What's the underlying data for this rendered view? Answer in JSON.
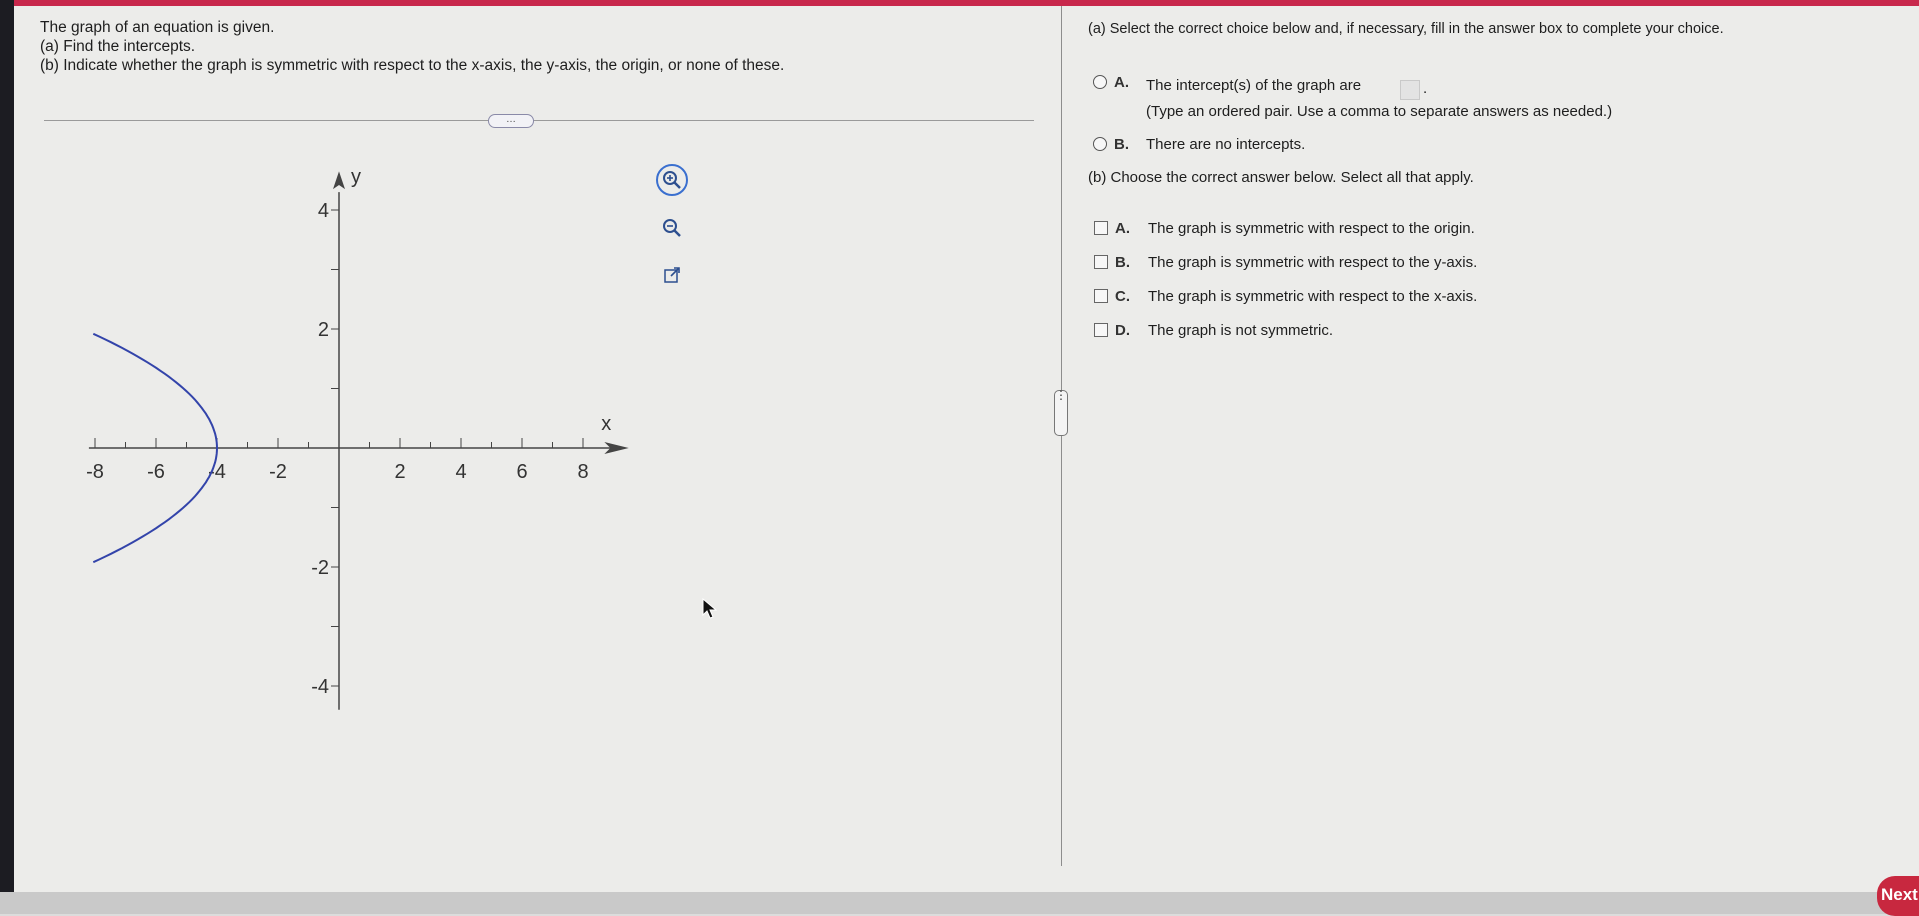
{
  "question": {
    "line1": "The graph of an equation is given.",
    "line2": "(a) Find the intercepts.",
    "line3": "(b) Indicate whether the graph is symmetric with respect to the x-axis, the y-axis, the origin, or none of these."
  },
  "more_button": "…",
  "tools": {
    "zoom_in_icon": "zoom-in-icon",
    "zoom_out_icon": "zoom-out-icon",
    "popout_icon": "external-link-icon"
  },
  "graph": {
    "x_label": "x",
    "y_label": "y",
    "x_ticks": [
      "-8",
      "-6",
      "-4",
      "-2",
      "2",
      "4",
      "6",
      "8"
    ],
    "y_ticks": [
      "4",
      "2",
      "-2",
      "-4"
    ],
    "curve_color": "#3344aa"
  },
  "part_a": {
    "prompt": "(a) Select the correct choice below and, if necessary, fill in the answer box to complete your choice.",
    "choices": [
      {
        "letter": "A.",
        "text": "The intercept(s) of the graph are",
        "hint": "(Type an ordered pair. Use a comma to separate answers as needed.)"
      },
      {
        "letter": "B.",
        "text": "There are no intercepts."
      }
    ],
    "period": "."
  },
  "part_b": {
    "prompt": "(b) Choose the correct answer below. Select all that apply.",
    "choices": [
      {
        "letter": "A.",
        "text": "The graph is symmetric with respect to the origin."
      },
      {
        "letter": "B.",
        "text": "The graph is symmetric with respect to the y-axis."
      },
      {
        "letter": "C.",
        "text": "The graph is symmetric with respect to the x-axis."
      },
      {
        "letter": "D.",
        "text": "The graph is not symmetric."
      }
    ]
  },
  "divider_handle": "⋮",
  "next_button": "Next",
  "colors": {
    "accent": "#c8283f",
    "focus": "#3a6fcf"
  }
}
